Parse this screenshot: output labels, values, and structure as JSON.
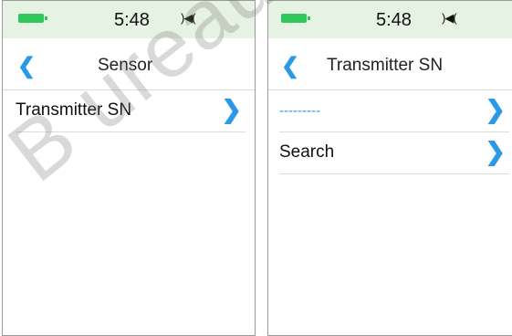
{
  "left": {
    "status": {
      "time": "5:48",
      "vibrate_icon": "vibrate-icon"
    },
    "nav": {
      "back_icon": "chevron-left-icon",
      "title": "Sensor"
    },
    "rows": [
      {
        "label": "Transmitter SN",
        "chevron": "chevron-right-icon"
      }
    ]
  },
  "right": {
    "status": {
      "time": "5:48",
      "vibrate_icon": "vibrate-icon"
    },
    "nav": {
      "back_icon": "chevron-left-icon",
      "title": "Transmitter SN"
    },
    "rows": [
      {
        "label": "---------",
        "chevron": "chevron-right-icon"
      },
      {
        "label": "Search",
        "chevron": "chevron-right-icon"
      }
    ]
  },
  "watermark": "B ureau",
  "colors": {
    "accent": "#2a9ae6",
    "statusbar_bg": "#e6f2e4",
    "battery": "#2fc65a"
  }
}
